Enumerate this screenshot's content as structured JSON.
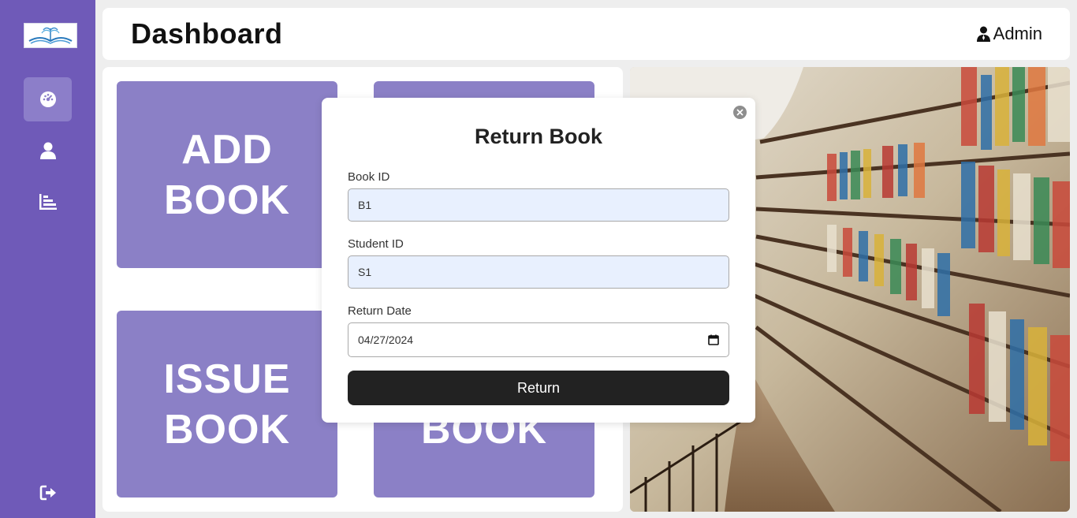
{
  "header": {
    "title": "Dashboard",
    "user_label": "Admin"
  },
  "sidebar": {
    "items": [
      {
        "icon": "gauge-icon",
        "active": true
      },
      {
        "icon": "user-icon",
        "active": false
      },
      {
        "icon": "bar-chart-icon",
        "active": false
      }
    ],
    "logout_icon": "logout-icon",
    "accent_color": "#6f5ab8"
  },
  "tiles": [
    {
      "line1": "ADD",
      "line2": "BOOK"
    },
    {
      "line1": "",
      "line2": ""
    },
    {
      "line1": "ISSUE",
      "line2": "BOOK"
    },
    {
      "line1": "",
      "line2": "BOOK"
    }
  ],
  "tile_color": "#8b80c6",
  "modal": {
    "title": "Return Book",
    "fields": {
      "book_id": {
        "label": "Book ID",
        "value": "B1"
      },
      "student_id": {
        "label": "Student ID",
        "value": "S1"
      },
      "return_date": {
        "label": "Return Date",
        "value": "04/27/2024"
      }
    },
    "submit_label": "Return"
  }
}
